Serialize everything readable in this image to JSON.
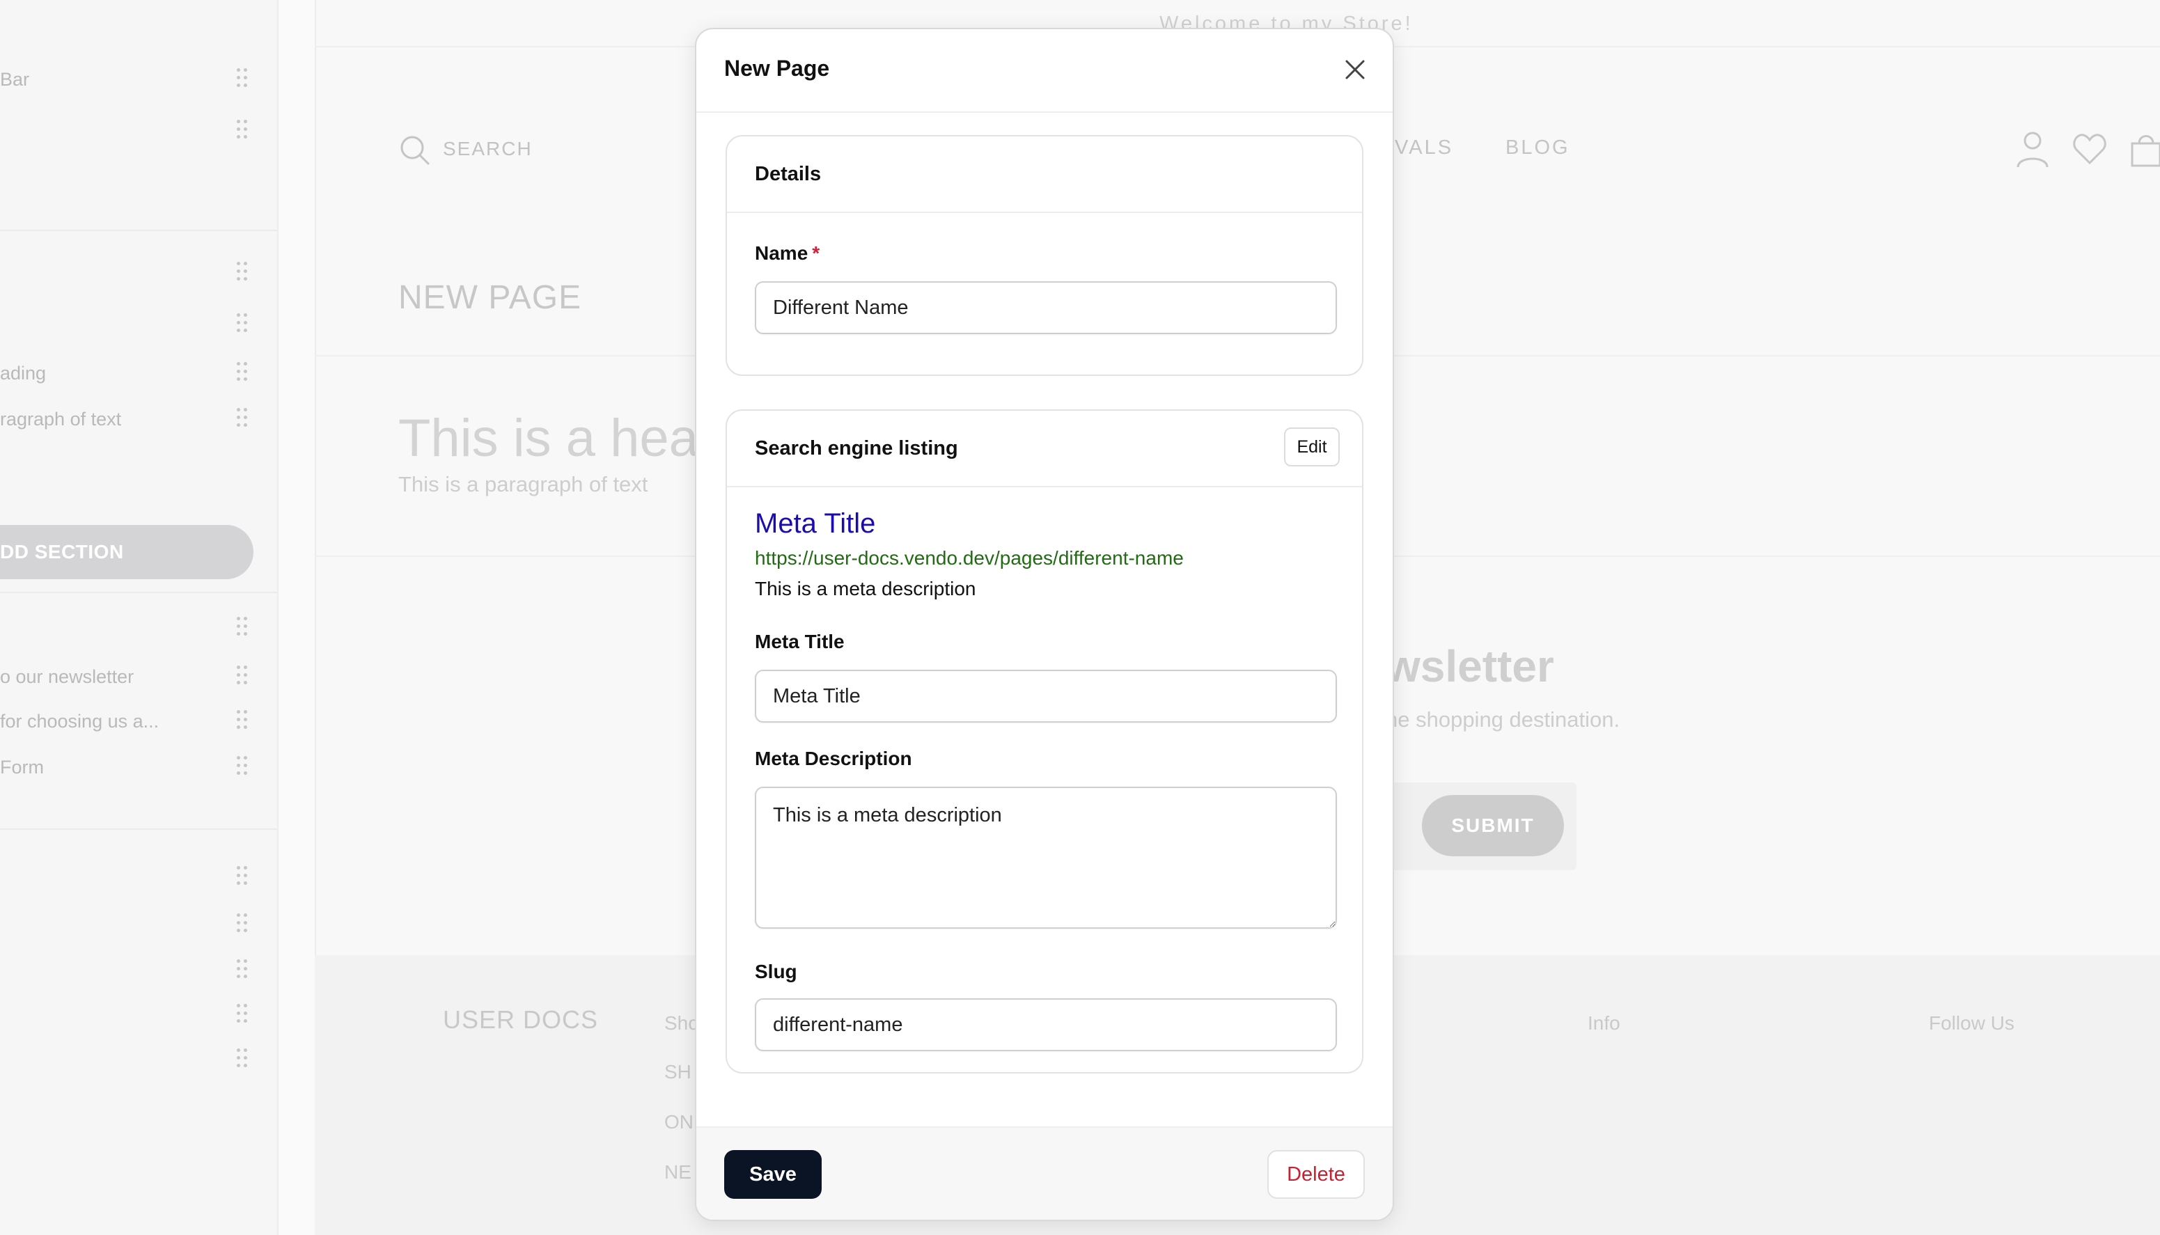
{
  "sidebar": {
    "rows": [
      {
        "label": "Bar"
      },
      {
        "label": ""
      },
      {
        "label": ""
      },
      {
        "label": ""
      },
      {
        "label": "ading"
      },
      {
        "label": "ragraph of text"
      },
      {
        "label": ""
      },
      {
        "label": "o our newsletter"
      },
      {
        "label": "for choosing us a..."
      },
      {
        "label": "Form"
      },
      {
        "label": ""
      },
      {
        "label": ""
      },
      {
        "label": ""
      },
      {
        "label": ""
      },
      {
        "label": ""
      }
    ],
    "add_section_label": "DD SECTION"
  },
  "store": {
    "welcome": "Welcome to my Store!",
    "search_label": "SEARCH",
    "nav": [
      "IVALS",
      "BLOG"
    ],
    "page_heading": "NEW PAGE",
    "heading": "This is a hea",
    "paragraph": "This is a paragraph of text",
    "newsletter_heading": "wsletter",
    "newsletter_sub": "ne shopping destination.",
    "submit_label": "SUBMIT",
    "footer_brand": "USER DOCS",
    "footer_col1": [
      "Sho",
      "SH",
      "ON",
      "NE"
    ],
    "footer_info": "Info",
    "footer_follow": "Follow Us"
  },
  "modal": {
    "title": "New Page",
    "details": {
      "title": "Details",
      "name_label": "Name",
      "required_mark": "*",
      "name_value": "Different Name"
    },
    "seo": {
      "title": "Search engine listing",
      "edit_label": "Edit",
      "preview_title": "Meta Title",
      "preview_url": "https://user-docs.vendo.dev/pages/different-name",
      "preview_description": "This is a meta description",
      "meta_title_label": "Meta Title",
      "meta_title_value": "Meta Title",
      "meta_description_label": "Meta Description",
      "meta_description_value": "This is a meta description",
      "slug_label": "Slug",
      "slug_value": "different-name"
    },
    "save_label": "Save",
    "delete_label": "Delete"
  },
  "colors": {
    "seo_title": "#1a0dab",
    "seo_url": "#216b13",
    "primary_button": "#0b1424",
    "danger": "#c8202f"
  }
}
